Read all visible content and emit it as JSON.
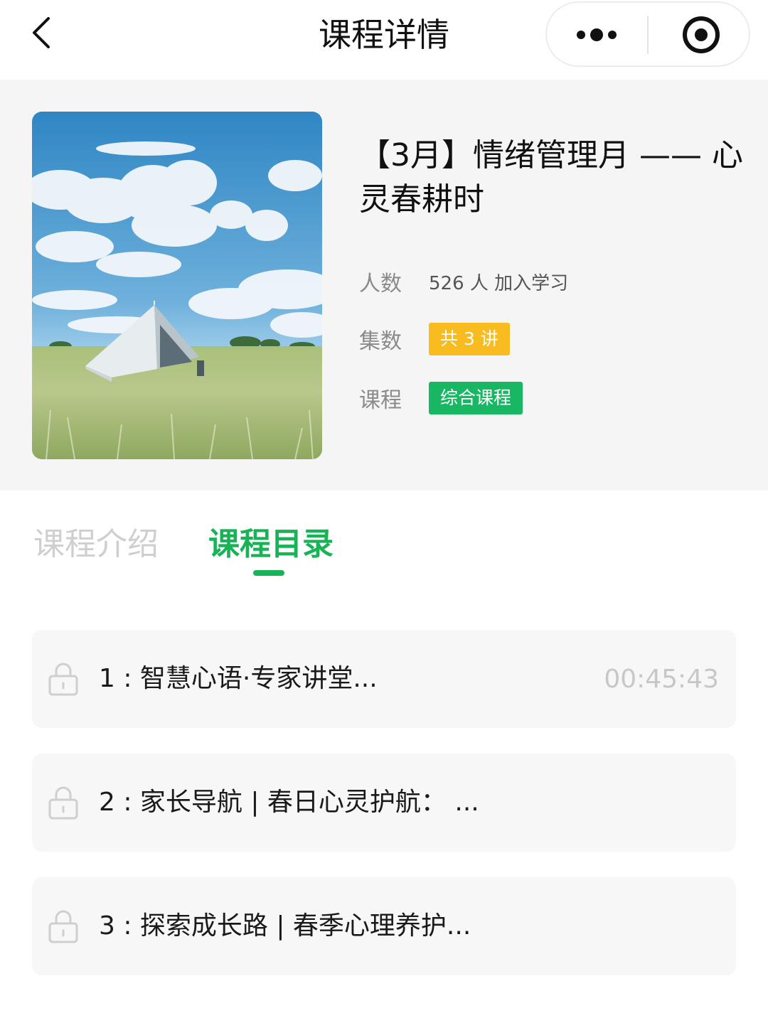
{
  "navbar": {
    "title": "课程详情"
  },
  "course": {
    "title": "【3月】情绪管理月 —— 心灵春耕时",
    "learners_label": "人数",
    "learners_value": "526 人 加入学习",
    "episodes_label": "集数",
    "episodes_value": "共 3 讲",
    "type_label": "课程",
    "type_value": "综合课程"
  },
  "tabs": [
    {
      "label": "课程介绍",
      "active": false
    },
    {
      "label": "课程目录",
      "active": true
    }
  ],
  "lessons": [
    {
      "title": "1 : 智慧心语·专家讲堂...",
      "duration": "00:45:43",
      "locked": true
    },
    {
      "title": "2 : 家长导航 | 春日心灵护航：  ...",
      "duration": "",
      "locked": true
    },
    {
      "title": "3 : 探索成长路 | 春季心理养护...",
      "duration": "",
      "locked": true
    }
  ],
  "colors": {
    "accent_green": "#18b356",
    "tag_yellow": "#f8bb20",
    "tag_green": "#19b663",
    "header_bg": "#f5f5f5"
  },
  "icons": [
    "back-arrow-icon",
    "more-dots-icon",
    "close-target-icon",
    "lock-icon"
  ]
}
